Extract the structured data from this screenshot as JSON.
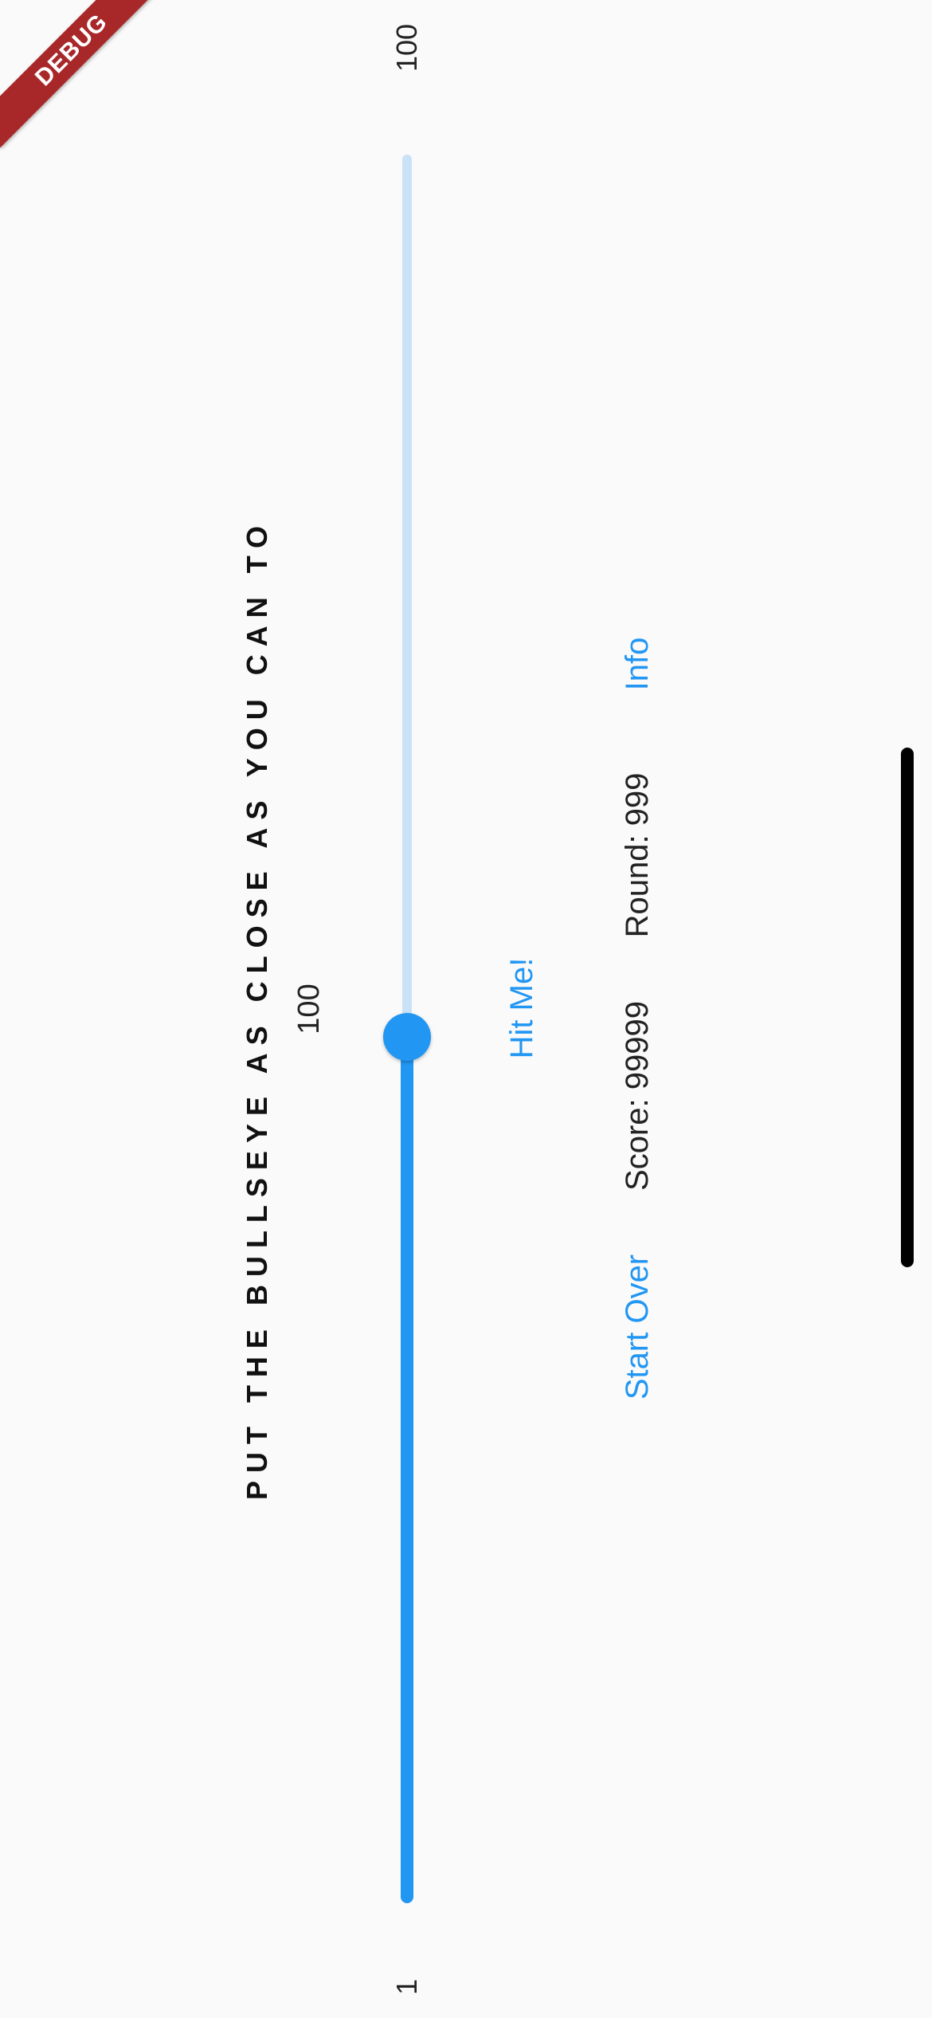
{
  "debug_banner": "DEBUG",
  "title": "PUT THE BULLSEYE AS CLOSE AS YOU CAN TO",
  "target_value": "100",
  "slider": {
    "min_label": "1",
    "max_label": "100",
    "value": 50,
    "min": 1,
    "max": 100,
    "active_color": "#2196f3",
    "inactive_color": "#c9e2f8"
  },
  "hit_button": "Hit Me!",
  "bottom_bar": {
    "start_over": "Start Over",
    "score": "Score: 99999",
    "round": "Round: 999",
    "info": "Info"
  },
  "colors": {
    "accent": "#2196f3",
    "background": "#fafafa",
    "debug": "#a8282a"
  }
}
